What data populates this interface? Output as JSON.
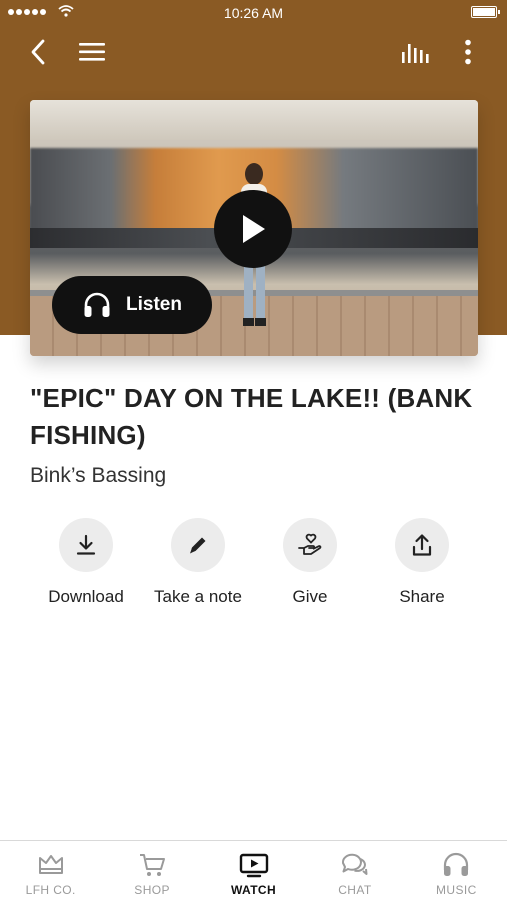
{
  "status_bar": {
    "time": "10:26 AM"
  },
  "topbar": {
    "back_icon": "chevron-left-icon",
    "menu_icon": "hamburger-icon",
    "equalizer_icon": "equalizer-icon",
    "more_icon": "vertical-dots-icon"
  },
  "media": {
    "play_icon": "play-icon",
    "listen_label": "Listen",
    "listen_icon": "headphones-icon"
  },
  "video": {
    "title": "\"EPIC\" DAY ON THE LAKE!! (BANK FISHING)",
    "channel": "Bink’s Bassing"
  },
  "actions": [
    {
      "label": "Download",
      "icon": "download-icon"
    },
    {
      "label": "Take a note",
      "icon": "pencil-icon"
    },
    {
      "label": "Give",
      "icon": "give-heart-hand-icon"
    },
    {
      "label": "Share",
      "icon": "share-icon"
    }
  ],
  "tabs": [
    {
      "label": "LFH CO.",
      "icon": "crown-icon",
      "active": false
    },
    {
      "label": "SHOP",
      "icon": "cart-icon",
      "active": false
    },
    {
      "label": "WATCH",
      "icon": "tv-play-icon",
      "active": true
    },
    {
      "label": "CHAT",
      "icon": "chat-bubbles-icon",
      "active": false
    },
    {
      "label": "MUSIC",
      "icon": "headphones-icon",
      "active": false
    }
  ],
  "colors": {
    "header_brown": "#8a5a24",
    "active_tab": "#111111",
    "inactive_tab": "#9a9a9a"
  }
}
